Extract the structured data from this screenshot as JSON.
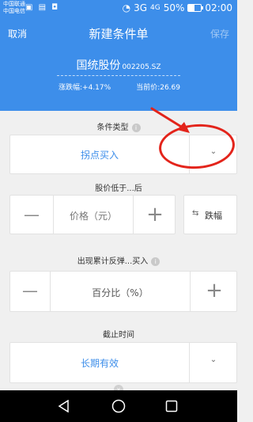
{
  "status": {
    "carrier1": "中国联通",
    "carrier2": "中国电信",
    "signal1": "3G",
    "signal2": "4G",
    "battery": "50%",
    "battery_level": 0.5,
    "time": "02:00"
  },
  "nav": {
    "cancel": "取消",
    "title": "新建条件单",
    "save": "保存"
  },
  "stock": {
    "name": "国统股份",
    "code": "002205.SZ",
    "change_label": "涨跌幅:",
    "change_value": "+4.17%",
    "price_label": "当前价:",
    "price_value": "26.69"
  },
  "condition_type": {
    "label": "条件类型",
    "value": "拐点买入"
  },
  "price_trigger": {
    "label": "股价低于...后",
    "minus": "—",
    "placeholder": "价格（元）",
    "plus": "+",
    "toggle_label": "跌幅"
  },
  "rebound": {
    "label": "出现累计反弹...买入",
    "minus": "—",
    "placeholder": "百分比（%）",
    "plus": "+"
  },
  "deadline": {
    "label": "截止时间",
    "value": "长期有效"
  },
  "info_glyph": "i",
  "icons": {
    "dropdown": "chevron-down-icon",
    "swap": "swap-icon",
    "back": "back-triangle-icon",
    "home": "home-circle-icon",
    "recents": "recents-square-icon"
  },
  "colors": {
    "header": "#3d8eea",
    "accent": "#3d8eea",
    "annotation": "#e3241b"
  }
}
